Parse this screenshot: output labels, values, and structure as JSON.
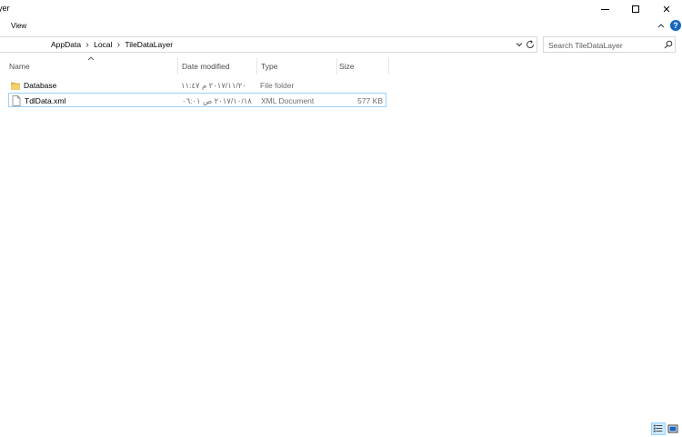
{
  "window": {
    "title": "yer",
    "close_glyph": "✕"
  },
  "ribbon": {
    "view_tab": "View",
    "help_glyph": "?"
  },
  "address": {
    "crumbs": [
      "AppData",
      "Local",
      "TileDataLayer"
    ],
    "separator": "›"
  },
  "search": {
    "placeholder": "Search TileDataLayer"
  },
  "columns": {
    "name": "Name",
    "date": "Date modified",
    "type": "Type",
    "size": "Size"
  },
  "files": [
    {
      "name": "Database",
      "date": "٢٠١٧/١١/٢٠ م ١١:٤٧",
      "type": "File folder",
      "size": "",
      "icon": "folder-icon"
    },
    {
      "name": "TdlData.xml",
      "date": "٢٠١٧/١٠/١٨ ص ٠٦:٠١",
      "type": "XML Document",
      "size": "577 KB",
      "icon": "file-icon",
      "selected": true
    }
  ],
  "colors": {
    "folder": "#e8b84a",
    "selection_border": "#99d1ff",
    "accent": "#1565c0"
  }
}
